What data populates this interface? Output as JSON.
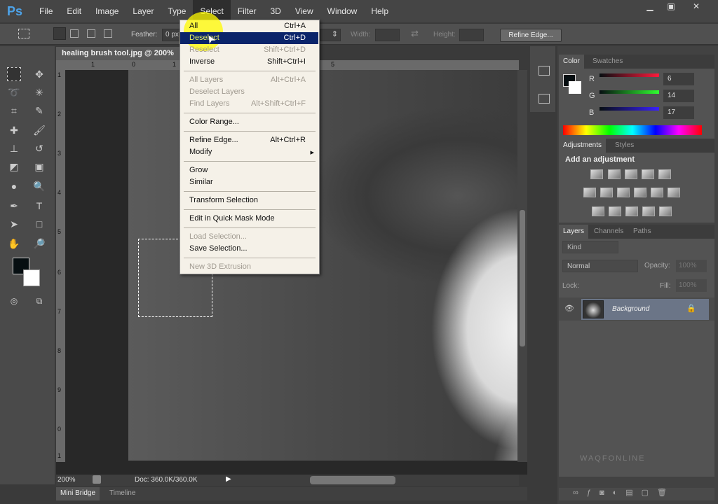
{
  "app": {
    "logo": "Ps",
    "menus": [
      "File",
      "Edit",
      "Image",
      "Layer",
      "Type",
      "Select",
      "Filter",
      "3D",
      "View",
      "Window",
      "Help"
    ],
    "active_menu": "Select"
  },
  "window_controls": [
    "minimize",
    "restore",
    "close"
  ],
  "options": {
    "feather_label": "Feather:",
    "feather_value": "0 px",
    "width_label": "Width:",
    "height_label": "Height:",
    "refine_edge": "Refine Edge..."
  },
  "document": {
    "tab_title": "healing brush tool.jpg @ 200%",
    "ruler_h": [
      "1",
      "0",
      "1",
      "5"
    ],
    "ruler_v": [
      "1",
      "2",
      "3",
      "4",
      "5",
      "6",
      "7",
      "8",
      "9",
      "0",
      "1"
    ],
    "zoom": "200%",
    "doc_info": "Doc: 360.0K/360.0K"
  },
  "bottom_tabs": [
    "Mini Bridge",
    "Timeline"
  ],
  "select_menu": [
    {
      "label": "All",
      "shortcut": "Ctrl+A",
      "state": "normal"
    },
    {
      "label": "Deselect",
      "shortcut": "Ctrl+D",
      "state": "highlighted"
    },
    {
      "label": "Reselect",
      "shortcut": "Shift+Ctrl+D",
      "state": "disabled"
    },
    {
      "label": "Inverse",
      "shortcut": "Shift+Ctrl+I",
      "state": "normal"
    },
    {
      "label": "All Layers",
      "shortcut": "Alt+Ctrl+A",
      "state": "disabled"
    },
    {
      "label": "Deselect Layers",
      "shortcut": "",
      "state": "disabled"
    },
    {
      "label": "Find Layers",
      "shortcut": "Alt+Shift+Ctrl+F",
      "state": "disabled"
    },
    {
      "label": "Color Range...",
      "shortcut": "",
      "state": "normal"
    },
    {
      "label": "Refine Edge...",
      "shortcut": "Alt+Ctrl+R",
      "state": "normal"
    },
    {
      "label": "Modify",
      "shortcut": "",
      "state": "submenu"
    },
    {
      "label": "Grow",
      "shortcut": "",
      "state": "normal"
    },
    {
      "label": "Similar",
      "shortcut": "",
      "state": "normal"
    },
    {
      "label": "Transform Selection",
      "shortcut": "",
      "state": "normal"
    },
    {
      "label": "Edit in Quick Mask Mode",
      "shortcut": "",
      "state": "normal"
    },
    {
      "label": "Load Selection...",
      "shortcut": "",
      "state": "disabled"
    },
    {
      "label": "Save Selection...",
      "shortcut": "",
      "state": "normal"
    },
    {
      "label": "New 3D Extrusion",
      "shortcut": "",
      "state": "disabled"
    }
  ],
  "color_panel": {
    "tabs": [
      "Color",
      "Swatches"
    ],
    "r_label": "R",
    "g_label": "G",
    "b_label": "B",
    "r": "6",
    "g": "14",
    "b": "17",
    "foreground": "#060e11",
    "background": "#ffffff"
  },
  "adjustments_panel": {
    "tabs": [
      "Adjustments",
      "Styles"
    ],
    "heading": "Add an adjustment"
  },
  "layers_panel": {
    "tabs": [
      "Layers",
      "Channels",
      "Paths"
    ],
    "filter": "Kind",
    "blend_mode": "Normal",
    "opacity_label": "Opacity:",
    "opacity": "100%",
    "lock_label": "Lock:",
    "fill_label": "Fill:",
    "fill": "100%",
    "layers": [
      {
        "name": "Background",
        "visible": true,
        "locked": true
      }
    ]
  },
  "watermark": "WAQFONLINE",
  "colors": {
    "accent": "#0a246a",
    "menu_bg": "#f5f1e8",
    "ui_bg": "#535353"
  }
}
